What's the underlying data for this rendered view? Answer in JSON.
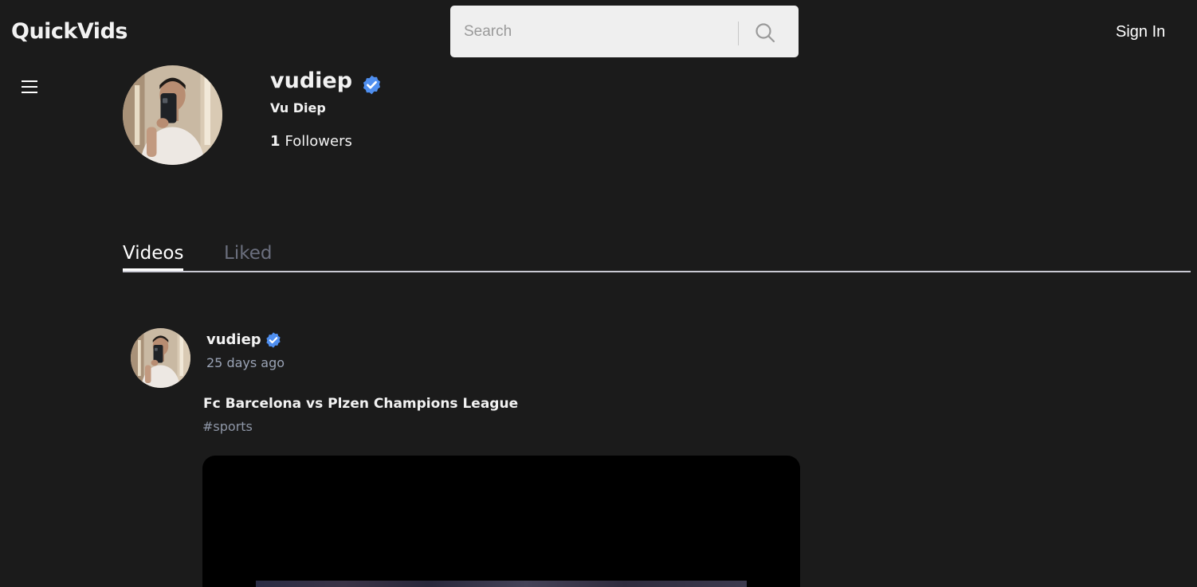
{
  "header": {
    "logo": "QuickVids",
    "search_placeholder": "Search",
    "sign_in_label": "Sign In"
  },
  "profile": {
    "username": "vudiep",
    "full_name": "Vu Diep",
    "followers_count": "1",
    "followers_label": "Followers",
    "verified": true
  },
  "tabs": [
    {
      "label": "Videos",
      "active": true
    },
    {
      "label": "Liked",
      "active": false
    }
  ],
  "post": {
    "username": "vudiep",
    "time_ago": "25 days ago",
    "title": "Fc Barcelona vs Plzen Champions League",
    "tag": "#sports"
  },
  "colors": {
    "background": "#1b1b1b",
    "verified_badge": "#4f8ff0",
    "inactive_tab": "#6b6f7e",
    "search_bg": "#efefef"
  },
  "icons": [
    "hamburger-menu-icon",
    "search-icon",
    "verified-badge-icon"
  ]
}
